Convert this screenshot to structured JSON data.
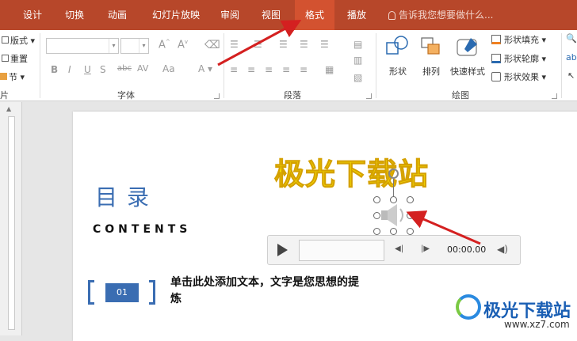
{
  "tabs": [
    {
      "label": "设计"
    },
    {
      "label": "切换"
    },
    {
      "label": "动画"
    },
    {
      "label": "幻灯片放映"
    },
    {
      "label": "审阅"
    },
    {
      "label": "视图"
    },
    {
      "label": "格式"
    },
    {
      "label": "播放"
    }
  ],
  "tell_me": "告诉我您想要做什么...",
  "ribbon": {
    "slides_group": {
      "layout": "版式",
      "reset": "重置",
      "section": "节",
      "label": "片"
    },
    "font_group": {
      "label": "字体",
      "abc": "abc",
      "av": "AV",
      "aa": "Aa"
    },
    "paragraph_group": {
      "label": "段落"
    },
    "drawing_group": {
      "label": "绘图",
      "shape": "形状",
      "arrange": "排列",
      "quick_styles": "快速样式",
      "shape_fill": "形状填充",
      "shape_outline": "形状轮廓",
      "shape_effects": "形状效果"
    }
  },
  "slide": {
    "title": "目录",
    "subtitle": "CONTENTS",
    "wordart": "极光下载站",
    "item_number": "01",
    "item_text": "单击此处添加文本，文字是您思想的提炼"
  },
  "player": {
    "time": "00:00.00"
  },
  "watermark": {
    "name": "极光下载站",
    "url": "www.xz7.com"
  },
  "colors": {
    "tab_bar": "#b7472a",
    "active_tab": "#d35230",
    "accent_blue": "#3a6db2",
    "arrow_red": "#d42020"
  }
}
